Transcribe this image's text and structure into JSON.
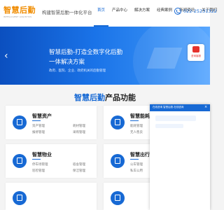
{
  "header": {
    "logo_text": "智慧后勤",
    "logo_sub": "INTELLIGENT LOGISTICS",
    "slogan": "构建智慧后勤一体化平台",
    "nav": [
      "首页",
      "产品中心",
      "解决方案",
      "经典案例",
      "新闻资讯",
      "关于我们"
    ],
    "active_nav": 0,
    "phone": "022-25231322"
  },
  "banner": {
    "headline_1": "智慧后勤-打造全数字化后勤",
    "headline_2": "一体解决方案",
    "description": "政府、医院、企业、政府机关的后勤管理"
  },
  "side_tab": {
    "label": "咨询客服"
  },
  "section": {
    "title_prefix": "智慧后勤",
    "title_suffix": "产品功能"
  },
  "cards": [
    {
      "title": "智慧资产",
      "items": [
        "资产管理",
        "耗材管理",
        "报修管理",
        "采购管理"
      ]
    },
    {
      "title": "智慧能耗",
      "items": [
        "能耗管理",
        "无人售卖"
      ]
    },
    {
      "title": "智慧物业",
      "items": [
        "停车场管理",
        "宿舍管理",
        "巡检管理",
        "保洁管理"
      ]
    },
    {
      "title": "智慧出行",
      "items": [
        "公车管理",
        "私车公用"
      ]
    }
  ],
  "chat": {
    "header": "在线咨询 智慧后勤-在线咨询"
  },
  "colors": {
    "primary": "#1769d4",
    "accent": "#f08c00",
    "alert": "#e5322d"
  }
}
